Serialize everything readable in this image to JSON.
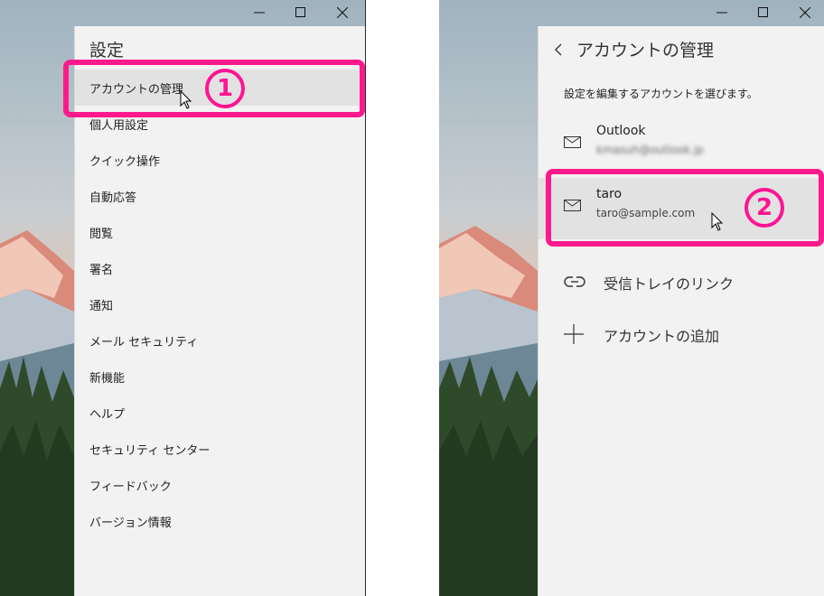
{
  "left": {
    "title": "設定",
    "items": [
      {
        "label": "アカウントの管理"
      },
      {
        "label": "個人用設定"
      },
      {
        "label": "クイック操作"
      },
      {
        "label": "自動応答"
      },
      {
        "label": "閲覧"
      },
      {
        "label": "署名"
      },
      {
        "label": "通知"
      },
      {
        "label": "メール セキュリティ"
      },
      {
        "label": "新機能"
      },
      {
        "label": "ヘルプ"
      },
      {
        "label": "セキュリティ センター"
      },
      {
        "label": "フィードバック"
      },
      {
        "label": "バージョン情報"
      }
    ],
    "step": "1"
  },
  "right": {
    "title": "アカウントの管理",
    "instruction": "設定を編集するアカウントを選びます。",
    "accounts": [
      {
        "name": "Outlook",
        "email": "kmasuh@outlook.jp"
      },
      {
        "name": "taro",
        "email": "taro@sample.com"
      }
    ],
    "actions": [
      {
        "label": "受信トレイのリンク",
        "icon": "link-icon"
      },
      {
        "label": "アカウントの追加",
        "icon": "plus-icon"
      }
    ],
    "step": "2"
  },
  "colors": {
    "highlight": "#ff1a8c",
    "pane": "#f2f2f2",
    "selected": "#e2e2e2"
  }
}
